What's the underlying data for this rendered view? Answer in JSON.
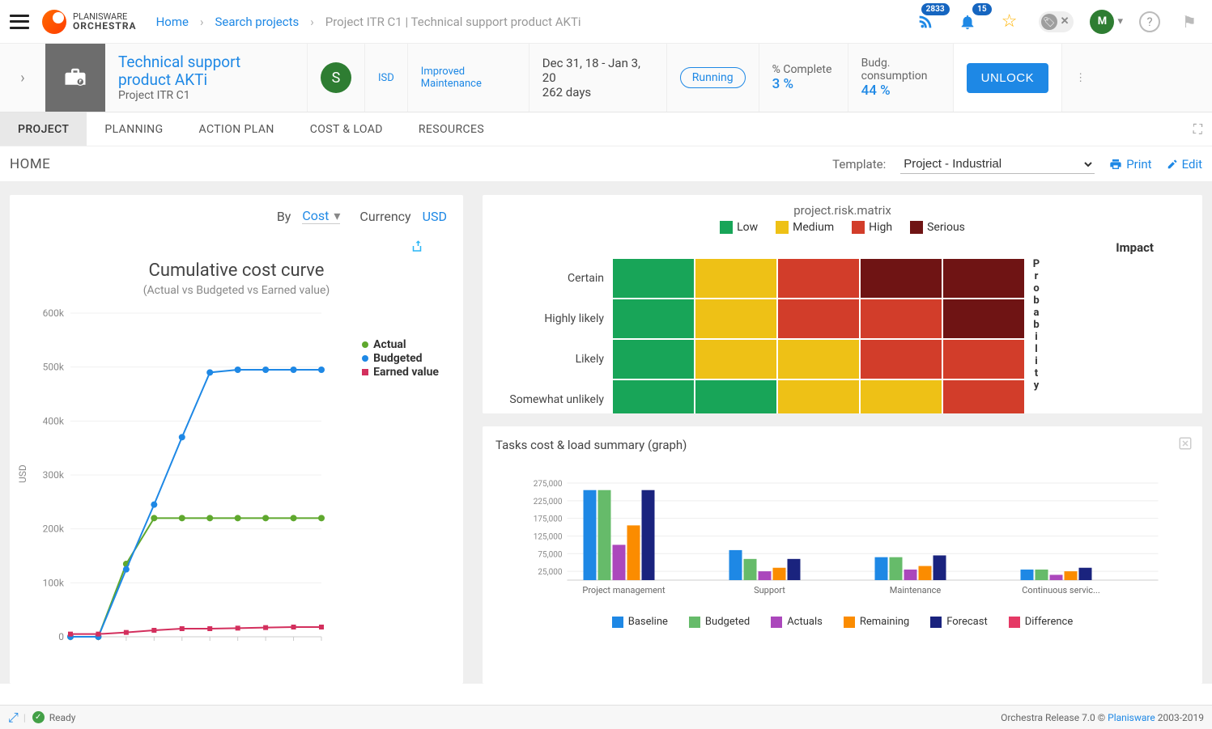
{
  "brand": {
    "line1": "PLANISWARE",
    "line2": "ORCHESTRA"
  },
  "breadcrumb": {
    "home": "Home",
    "search": "Search projects",
    "current": "Project ITR C1 | Technical support product AKTi"
  },
  "notif": {
    "feed_count": "2833",
    "bell_count": "15"
  },
  "avatar": "M",
  "project": {
    "title": "Technical support product AKTi",
    "code": "Project ITR C1",
    "s": "S",
    "dept": "ISD",
    "stage1": "Improved",
    "stage2": "Maintenance",
    "dates": "Dec 31, 18 - Jan 3, 20",
    "duration": "262 days",
    "status": "Running",
    "m1_label": "% Complete",
    "m1_val": "3 %",
    "m2_label": "Budg. consumption",
    "m2_val": "44 %",
    "unlock": "UNLOCK"
  },
  "tabs": [
    "PROJECT",
    "PLANNING",
    "ACTION PLAN",
    "COST & LOAD",
    "RESOURCES"
  ],
  "sub": {
    "title": "HOME",
    "tmpl_label": "Template:",
    "tmpl": "Project - Industrial",
    "print": "Print",
    "edit": "Edit"
  },
  "left_chart": {
    "by": "By",
    "cost": "Cost",
    "currency_label": "Currency",
    "currency": "USD",
    "title": "Cumulative cost curve",
    "sub": "(Actual vs Budgeted vs Earned value)",
    "legend": {
      "a": "Actual",
      "b": "Budgeted",
      "e": "Earned value"
    },
    "ylabel": "USD"
  },
  "risk": {
    "title": "project.risk.matrix",
    "legend": {
      "low": "Low",
      "med": "Medium",
      "high": "High",
      "ser": "Serious"
    },
    "impact": "Impact",
    "prob": "Probability",
    "rows": [
      "Certain",
      "Highly likely",
      "Likely",
      "Somewhat unlikely"
    ]
  },
  "bc": {
    "title": "Tasks cost & load summary (graph)",
    "legend": [
      "Baseline",
      "Budgeted",
      "Actuals",
      "Remaining",
      "Forecast",
      "Difference"
    ],
    "cats": [
      "Project management",
      "Support",
      "Maintenance",
      "Continuous servic..."
    ]
  },
  "footer": {
    "ready": "Ready",
    "release": "Orchestra Release 7.0 © ",
    "pw": "Planisware",
    "years": " 2003-2019"
  },
  "chart_data": [
    {
      "type": "line",
      "title": "Cumulative cost curve",
      "ylabel": "USD",
      "ylim": [
        0,
        600000
      ],
      "x": [
        0,
        1,
        2,
        3,
        4,
        5,
        6,
        7,
        8,
        9
      ],
      "series": [
        {
          "name": "Actual",
          "color": "#5fa82e",
          "values": [
            0,
            0,
            135000,
            220000,
            220000,
            220000,
            220000,
            220000,
            220000,
            220000
          ]
        },
        {
          "name": "Budgeted",
          "color": "#1e88e5",
          "values": [
            0,
            0,
            125000,
            245000,
            370000,
            490000,
            495000,
            495000,
            495000,
            495000
          ]
        },
        {
          "name": "Earned value",
          "color": "#d32f5d",
          "values": [
            5000,
            5000,
            8000,
            12000,
            15000,
            15000,
            16000,
            17000,
            18000,
            18000
          ]
        }
      ],
      "yticks": [
        "0",
        "100k",
        "200k",
        "300k",
        "400k",
        "500k",
        "600k"
      ]
    },
    {
      "type": "heatmap",
      "title": "project.risk.matrix",
      "xlabel": "Impact",
      "ylabel": "Probability",
      "rows": [
        "Certain",
        "Highly likely",
        "Likely",
        "Somewhat unlikely"
      ],
      "grid": [
        [
          "low",
          "med",
          "high",
          "ser",
          "ser"
        ],
        [
          "low",
          "med",
          "high",
          "high",
          "ser"
        ],
        [
          "low",
          "med",
          "med",
          "high",
          "high"
        ],
        [
          "low",
          "low",
          "med",
          "med",
          "high"
        ]
      ],
      "colors": {
        "low": "#18a558",
        "med": "#eec116",
        "high": "#d23d2a",
        "ser": "#6f1414"
      }
    },
    {
      "type": "bar",
      "title": "Tasks cost & load summary (graph)",
      "ylim": [
        0,
        275000
      ],
      "yticks": [
        25000,
        75000,
        125000,
        175000,
        225000,
        275000
      ],
      "categories": [
        "Project management",
        "Support",
        "Maintenance",
        "Continuous servic..."
      ],
      "series": [
        {
          "name": "Baseline",
          "color": "#1e88e5",
          "values": [
            255000,
            85000,
            65000,
            30000
          ]
        },
        {
          "name": "Budgeted",
          "color": "#66bb6a",
          "values": [
            255000,
            60000,
            65000,
            30000
          ]
        },
        {
          "name": "Actuals",
          "color": "#ab47bc",
          "values": [
            100000,
            25000,
            30000,
            15000
          ]
        },
        {
          "name": "Remaining",
          "color": "#fb8c00",
          "values": [
            155000,
            35000,
            40000,
            25000
          ]
        },
        {
          "name": "Forecast",
          "color": "#1a237e",
          "values": [
            255000,
            60000,
            70000,
            35000
          ]
        },
        {
          "name": "Difference",
          "color": "#e53965",
          "values": [
            0,
            0,
            0,
            0
          ]
        }
      ]
    }
  ]
}
